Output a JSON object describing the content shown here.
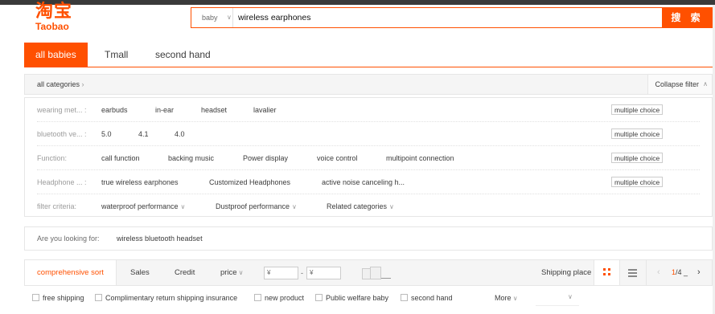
{
  "logo": {
    "cn": "淘宝",
    "en": "Taobao"
  },
  "search": {
    "scope": "baby",
    "value": "wireless earphones",
    "button_label": "搜 索"
  },
  "tabs": [
    "all babies",
    "Tmall",
    "second hand"
  ],
  "nav": {
    "all_categories": "all categories",
    "collapse_filter": "Collapse filter"
  },
  "attributes": [
    {
      "key": "wearing met... :",
      "values": [
        "earbuds",
        "in-ear",
        "headset",
        "lavalier"
      ],
      "multi": "multiple choice"
    },
    {
      "key": "bluetooth ve... :",
      "values": [
        "5.0",
        "4.1",
        "4.0"
      ],
      "multi": "multiple choice"
    },
    {
      "key": "Function:",
      "values": [
        "call function",
        "backing music",
        "Power display",
        "voice control",
        "multipoint connection"
      ],
      "multi": "multiple choice"
    },
    {
      "key": "Headphone ... :",
      "values": [
        "true wireless earphones",
        "Customized Headphones",
        "active noise canceling h..."
      ],
      "multi": "multiple choice"
    },
    {
      "key": "filter criteria:",
      "values": [
        "waterproof performance",
        "Dustproof performance",
        "Related categories"
      ]
    }
  ],
  "suggest": {
    "label": "Are you looking for:",
    "items": [
      "wireless bluetooth headset"
    ]
  },
  "sort": {
    "options": [
      "comprehensive sort",
      "Sales",
      "Credit",
      "price"
    ],
    "price_min_placeholder": "¥",
    "price_max_placeholder": "¥",
    "price_dash": "-",
    "shipping_place": "Shipping place",
    "page_current": "1",
    "page_total": "/4",
    "page_cursor": "_"
  },
  "filters": {
    "checkboxes": [
      "free shipping",
      "Complimentary return shipping insurance",
      "new product",
      "Public welfare baby",
      "second hand"
    ],
    "more": "More"
  },
  "colors": {
    "accent": "#ff5000"
  }
}
